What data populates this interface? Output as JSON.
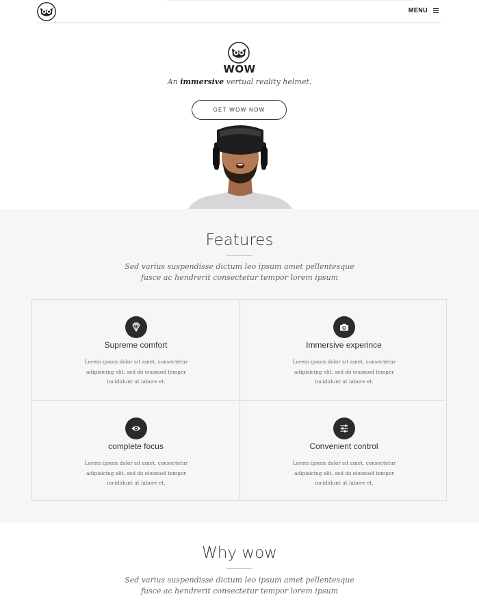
{
  "header": {
    "logo_icon": "owl-logo-icon",
    "menu_label": "MENU",
    "menu_icon": "hamburger-icon"
  },
  "hero": {
    "brand": "WOW",
    "tagline_prefix": "An ",
    "tagline_emphasis": "immersive",
    "tagline_suffix": " vertual reality helmet.",
    "cta_label": "GET WOW NOW",
    "image": "man-wearing-vr-headset"
  },
  "features": {
    "title": "Features",
    "subtitle_line1": "Sed varius suspendisse dictum leo ipsum amet pellentesque",
    "subtitle_line2": "fusce ac hendrerit consectetur tempor lorem ipsum",
    "items": [
      {
        "icon": "diamond-icon",
        "title": "Supreme comfort",
        "text": "Lorem ipsum dolor sit amet, consectetur adipisicing elit, sed do eiusmod tempor incididunt ut labore et."
      },
      {
        "icon": "camera-icon",
        "title": "Immersive experince",
        "text": "Lorem ipsum dolor sit amet, consectetur adipisicing elit, sed do eiusmod tempor incididunt ut labore et."
      },
      {
        "icon": "eye-icon",
        "title": "complete focus",
        "text": "Lorem ipsum dolor sit amet, consectetur adipisicing elit, sed do eiusmod tempor incididunt ut labore et."
      },
      {
        "icon": "sliders-icon",
        "title": "Convenient control",
        "text": "Lorem ipsum dolor sit amet, consectetur adipisicing elit, sed do eiusmod tempor incididunt ut labore et."
      }
    ]
  },
  "why": {
    "title": "Why wow",
    "subtitle_line1": "Sed varius suspendisse dictum leo ipsum amet pellentesque",
    "subtitle_line2": "fusce ac hendrerit consectetur tempor lorem ipsum"
  }
}
